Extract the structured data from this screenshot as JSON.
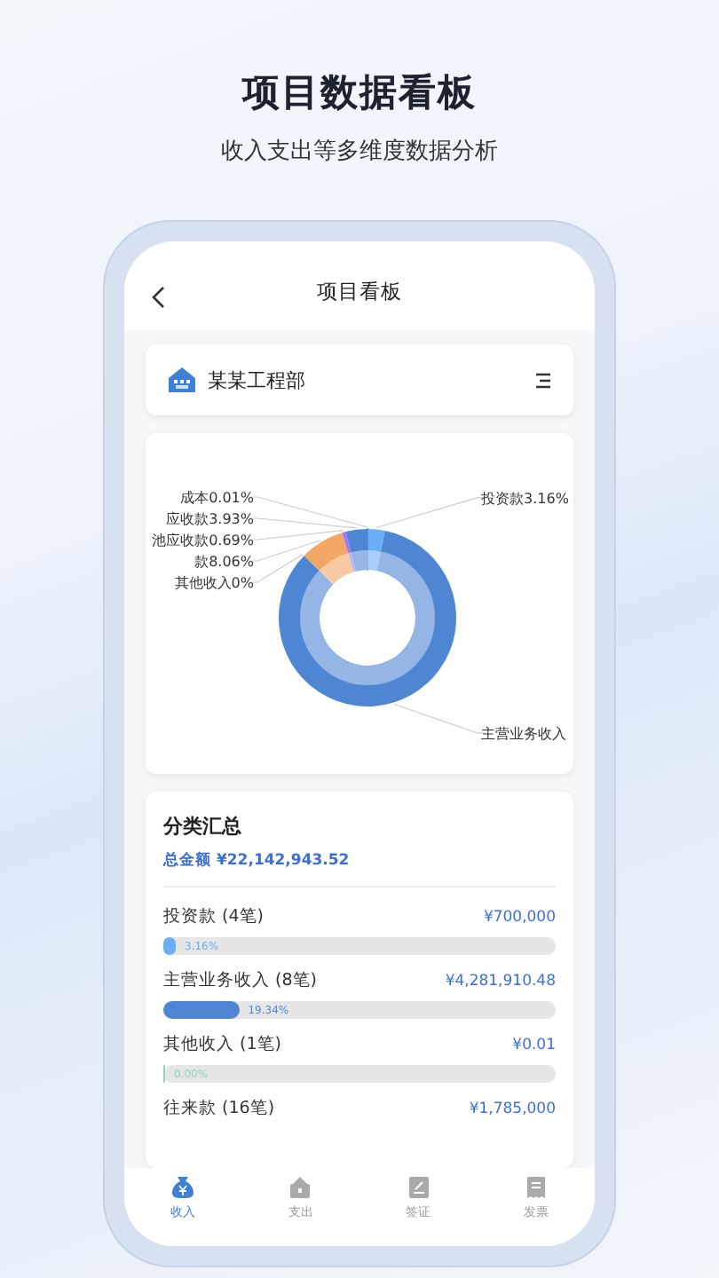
{
  "headline": {
    "title": "项目数据看板",
    "subtitle": "收入支出等多维度数据分析"
  },
  "nav": {
    "title": "项目看板"
  },
  "project": {
    "name": "某某工程部"
  },
  "chart_data": {
    "type": "donut",
    "categories": [
      "投资款3.16%",
      "主营业务收入",
      "其他收入0%",
      "款8.06%",
      "池应收款0.69%",
      "应收款3.93%",
      "成本0.01%"
    ],
    "series": [
      {
        "values": [
          3.16,
          84.15,
          0,
          8.06,
          0.69,
          3.93,
          0.01
        ],
        "colors": [
          "#6aaef5",
          "#4f86d4",
          "#8fd3c0",
          "#f2a766",
          "#a27af2",
          "#4f86d4",
          "#4f86d4"
        ]
      }
    ]
  },
  "summary": {
    "title": "分类汇总",
    "total_label": "总金额",
    "total": "¥22,142,943.52",
    "rows": [
      {
        "name": "投资款 (4笔)",
        "amount": "¥700,000",
        "level": 0.0316,
        "percent": "3.16%",
        "color": "#6aaef5"
      },
      {
        "name": "主营业务收入 (8笔)",
        "amount": "¥4,281,910.48",
        "level": 0.1934,
        "percent": "19.34%",
        "color": "#4f86d4"
      },
      {
        "name": "其他收入 (1笔)",
        "amount": "¥0.01",
        "level": 0,
        "percent": "0.00%",
        "color": "#8fd3c0"
      },
      {
        "name": "往来款 (16笔)",
        "amount": "¥1,785,000"
      }
    ]
  },
  "tabs": [
    {
      "label": "收入",
      "kind": "income",
      "selected": true
    },
    {
      "label": "支出",
      "kind": "expense",
      "selected": false
    },
    {
      "label": "签证",
      "kind": "visa",
      "selected": false
    },
    {
      "label": "发票",
      "kind": "invoice",
      "selected": false
    }
  ]
}
